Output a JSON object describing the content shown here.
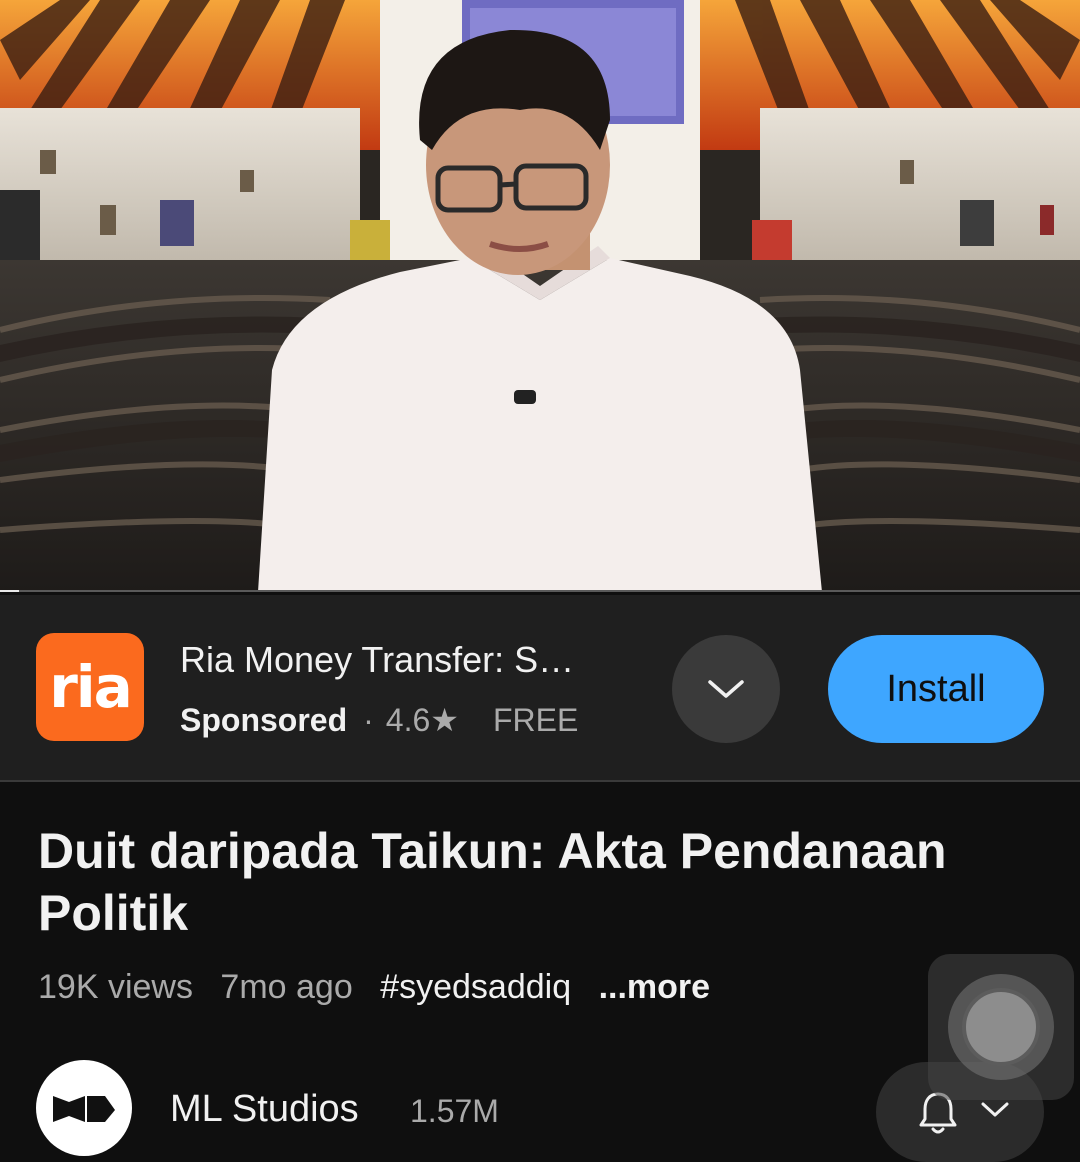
{
  "player": {
    "progress_fraction": 0.018
  },
  "ad": {
    "logo_text": "ria",
    "logo_color": "#fb6a1e",
    "title": "Ria Money Transfer: S…",
    "sponsored": "Sponsored",
    "separator": "·",
    "rating": "4.6★",
    "price": "FREE",
    "expand_icon": "chevron-down-icon",
    "install_label": "Install",
    "install_color": "#3ea6ff"
  },
  "video": {
    "title": "Duit daripada Taikun: Akta Pendanaan Politik",
    "views": "19K views",
    "age": "7mo ago",
    "hashtag": "#syedsaddiq",
    "more": "...more"
  },
  "channel": {
    "name": "ML Studios",
    "subscribers": "1.57M",
    "bell_icon": "bell-icon",
    "chevron_icon": "chevron-down-icon"
  }
}
